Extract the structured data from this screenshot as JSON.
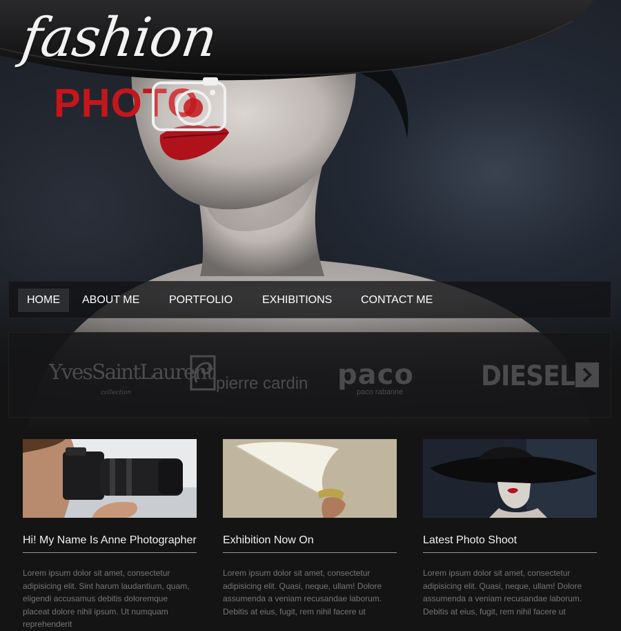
{
  "logo": {
    "script_word": "fashion",
    "photo_word": "PHOTO",
    "script_color": "#f2f2f2",
    "photo_color": "#c4161c"
  },
  "nav": {
    "items": [
      {
        "label": "HOME",
        "active": true
      },
      {
        "label": "ABOUT ME",
        "active": false
      },
      {
        "label": "PORTFOLIO",
        "active": false
      },
      {
        "label": "EXHIBITIONS",
        "active": false
      },
      {
        "label": "CONTACT ME",
        "active": false
      }
    ]
  },
  "brands": {
    "ysl": "YvesSaintLaurent",
    "ysl_sub": "collection",
    "pierre_cardin": "pierre cardin",
    "paco": "paco",
    "paco_sub": "paco rabanne",
    "diesel": "DIESEL",
    "next_icon": "chevron-right-icon"
  },
  "columns": [
    {
      "title": "Hi! My Name Is Anne Photographer",
      "text": "Lorem ipsum dolor sit amet, consectetur adipisicing elit. Sint harum laudantium, quam, eligendi accusamus debitis doloremque placeat dolore nihil ipsum. Ut numquam reprehenderit"
    },
    {
      "title": "Exhibition Now On",
      "text": "Lorem ipsum dolor sit amet, consectetur adipisicing elit. Quasi, neque, ullam! Dolore assumenda a veniam recusandae laborum. Debitis at eius, fugit, rem nihil facere ut"
    },
    {
      "title": "Latest Photo Shoot",
      "text": "Lorem ipsum dolor sit amet, consectetur adipisicing elit. Quasi, neque, ullam! Dolore assumenda a veniam recusandae laborum. Debitis at eius, fugit, rem nihil facere ut"
    }
  ]
}
